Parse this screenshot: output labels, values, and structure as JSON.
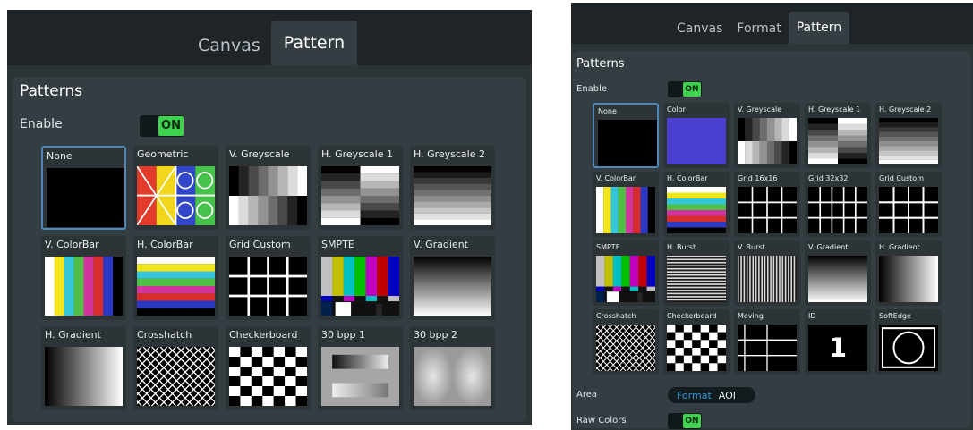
{
  "left": {
    "tabs": [
      {
        "label": "Canvas",
        "active": false
      },
      {
        "label": "Pattern",
        "active": true
      }
    ],
    "section_title": "Patterns",
    "enable_label": "Enable",
    "enable_state": "ON",
    "patterns": [
      {
        "label": "None",
        "icon": "none-pattern-icon",
        "selected": true
      },
      {
        "label": "Geometric",
        "icon": "geometric-pattern-icon",
        "selected": false
      },
      {
        "label": "V. Greyscale",
        "icon": "v-greyscale-pattern-icon",
        "selected": false
      },
      {
        "label": "H. Greyscale 1",
        "icon": "h-greyscale-1-pattern-icon",
        "selected": false
      },
      {
        "label": "H. Greyscale 2",
        "icon": "h-greyscale-2-pattern-icon",
        "selected": false
      },
      {
        "label": "V. ColorBar",
        "icon": "v-colorbar-pattern-icon",
        "selected": false
      },
      {
        "label": "H. ColorBar",
        "icon": "h-colorbar-pattern-icon",
        "selected": false
      },
      {
        "label": "Grid Custom",
        "icon": "grid-custom-pattern-icon",
        "selected": false
      },
      {
        "label": "SMPTE",
        "icon": "smpte-pattern-icon",
        "selected": false
      },
      {
        "label": "V. Gradient",
        "icon": "v-gradient-pattern-icon",
        "selected": false
      },
      {
        "label": "H. Gradient",
        "icon": "h-gradient-pattern-icon",
        "selected": false
      },
      {
        "label": "Crosshatch",
        "icon": "crosshatch-pattern-icon",
        "selected": false
      },
      {
        "label": "Checkerboard",
        "icon": "checkerboard-pattern-icon",
        "selected": false
      },
      {
        "label": "30 bpp 1",
        "icon": "30bpp-1-pattern-icon",
        "selected": false
      },
      {
        "label": "30 bpp 2",
        "icon": "30bpp-2-pattern-icon",
        "selected": false
      }
    ]
  },
  "right": {
    "tabs": [
      {
        "label": "Canvas",
        "active": false
      },
      {
        "label": "Format",
        "active": false
      },
      {
        "label": "Pattern",
        "active": true
      }
    ],
    "section_title": "Patterns",
    "enable_label": "Enable",
    "enable_state": "ON",
    "patterns": [
      {
        "label": "None",
        "icon": "none-pattern-icon",
        "selected": true
      },
      {
        "label": "Color",
        "icon": "color-pattern-icon",
        "selected": false
      },
      {
        "label": "V. Greyscale",
        "icon": "v-greyscale-pattern-icon",
        "selected": false
      },
      {
        "label": "H. Greyscale 1",
        "icon": "h-greyscale-1-pattern-icon",
        "selected": false
      },
      {
        "label": "H. Greyscale 2",
        "icon": "h-greyscale-2-pattern-icon",
        "selected": false
      },
      {
        "label": "V. ColorBar",
        "icon": "v-colorbar-pattern-icon",
        "selected": false
      },
      {
        "label": "H. ColorBar",
        "icon": "h-colorbar-pattern-icon",
        "selected": false
      },
      {
        "label": "Grid 16x16",
        "icon": "grid-16-pattern-icon",
        "selected": false
      },
      {
        "label": "Grid 32x32",
        "icon": "grid-32-pattern-icon",
        "selected": false
      },
      {
        "label": "Grid Custom",
        "icon": "grid-custom-pattern-icon",
        "selected": false
      },
      {
        "label": "SMPTE",
        "icon": "smpte-pattern-icon",
        "selected": false
      },
      {
        "label": "H. Burst",
        "icon": "h-burst-pattern-icon",
        "selected": false
      },
      {
        "label": "V. Burst",
        "icon": "v-burst-pattern-icon",
        "selected": false
      },
      {
        "label": "V. Gradient",
        "icon": "v-gradient-pattern-icon",
        "selected": false
      },
      {
        "label": "H. Gradient",
        "icon": "h-gradient-pattern-icon",
        "selected": false
      },
      {
        "label": "Crosshatch",
        "icon": "crosshatch-pattern-icon",
        "selected": false
      },
      {
        "label": "Checkerboard",
        "icon": "checkerboard-pattern-icon",
        "selected": false
      },
      {
        "label": "Moving",
        "icon": "moving-pattern-icon",
        "selected": false
      },
      {
        "label": "ID",
        "icon": "id-pattern-icon",
        "selected": false,
        "id_value": "1"
      },
      {
        "label": "SoftEdge",
        "icon": "softedge-pattern-icon",
        "selected": false
      }
    ],
    "area_label": "Area",
    "area_options": [
      {
        "label": "Format",
        "active": true
      },
      {
        "label": "AOI",
        "active": false
      }
    ],
    "raw_colors_label": "Raw Colors",
    "raw_colors_state": "ON"
  },
  "colors": {
    "selected_border": "#4f86b8",
    "toggle_on": "#3fd24e",
    "color_swatch": "#4a3fd0",
    "segment_active": "#2f9bd3"
  }
}
